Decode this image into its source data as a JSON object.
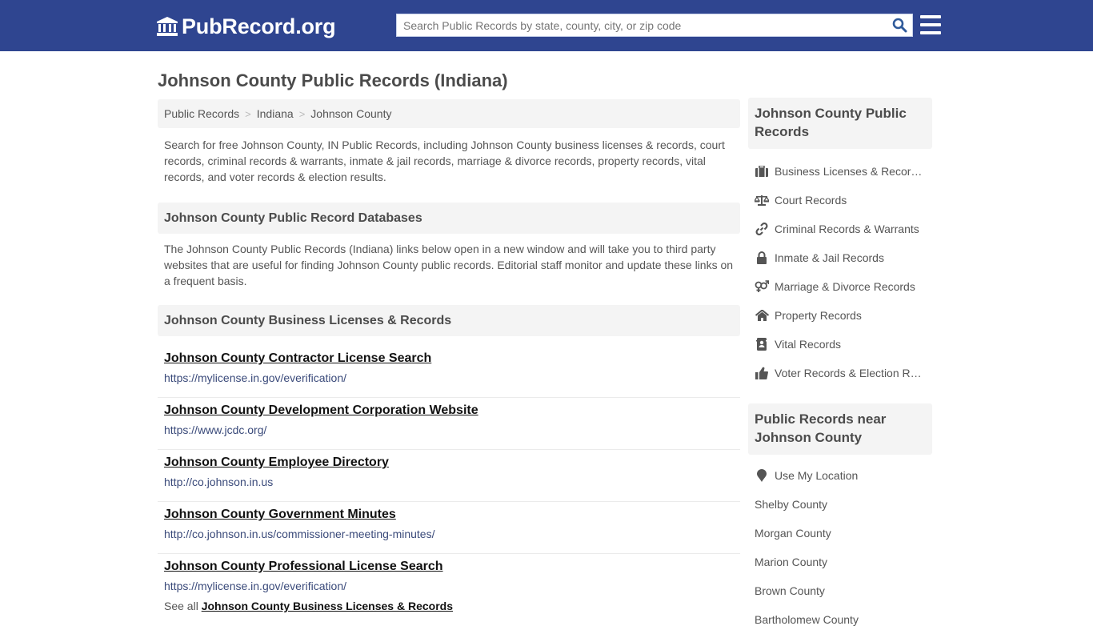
{
  "header": {
    "logo_text": "PubRecord.org",
    "search_placeholder": "Search Public Records by state, county, city, or zip code",
    "search_value": "",
    "brand_color": "#2f4590",
    "search_icon_color": "#2f5a9a"
  },
  "page": {
    "title": "Johnson County Public Records (Indiana)"
  },
  "breadcrumb": [
    {
      "label": "Public Records"
    },
    {
      "label": "Indiana"
    },
    {
      "label": "Johnson County"
    }
  ],
  "intro": "Search for free Johnson County, IN Public Records, including Johnson County business licenses & records, court records, criminal records & warrants, inmate & jail records, marriage & divorce records, property records, vital records, and voter records & election results.",
  "databases": {
    "heading": "Johnson County Public Record Databases",
    "description": "The Johnson County Public Records (Indiana) links below open in a new window and will take you to third party websites that are useful for finding Johnson County public records. Editorial staff monitor and update these links on a frequent basis."
  },
  "business": {
    "heading": "Johnson County Business Licenses & Records",
    "records": [
      {
        "title": "Johnson County Contractor License Search",
        "url": "https://mylicense.in.gov/everification/"
      },
      {
        "title": "Johnson County Development Corporation Website",
        "url": "https://www.jcdc.org/"
      },
      {
        "title": "Johnson County Employee Directory",
        "url": "http://co.johnson.in.us"
      },
      {
        "title": "Johnson County Government Minutes",
        "url": "http://co.johnson.in.us/commissioner-meeting-minutes/"
      },
      {
        "title": "Johnson County Professional License Search",
        "url": "https://mylicense.in.gov/everification/"
      }
    ],
    "see_all_prefix": "See all",
    "see_all_link": "Johnson County Business Licenses & Records"
  },
  "sidebar": {
    "heading": "Johnson County Public Records",
    "items": [
      {
        "label": "Business Licenses & Records",
        "icon": "briefcase-icon"
      },
      {
        "label": "Court Records",
        "icon": "scale-icon"
      },
      {
        "label": "Criminal Records & Warrants",
        "icon": "link-icon"
      },
      {
        "label": "Inmate & Jail Records",
        "icon": "lock-icon"
      },
      {
        "label": "Marriage & Divorce Records",
        "icon": "gender-icon"
      },
      {
        "label": "Property Records",
        "icon": "home-icon"
      },
      {
        "label": "Vital Records",
        "icon": "address-book-icon"
      },
      {
        "label": "Voter Records & Election Results",
        "icon": "thumbs-up-icon"
      }
    ],
    "near_heading": "Public Records near Johnson County",
    "use_location": "Use My Location",
    "nearby": [
      {
        "label": "Shelby County"
      },
      {
        "label": "Morgan County"
      },
      {
        "label": "Marion County"
      },
      {
        "label": "Brown County"
      },
      {
        "label": "Bartholomew County"
      }
    ]
  }
}
